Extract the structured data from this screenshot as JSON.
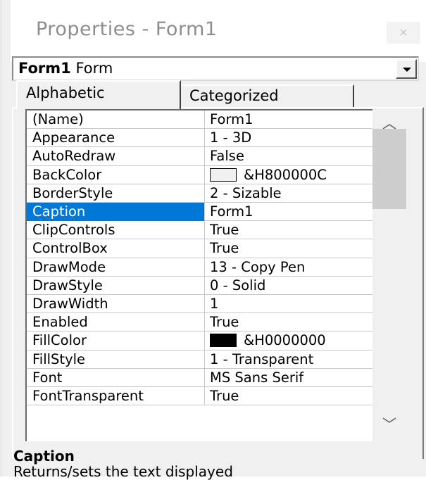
{
  "window": {
    "title": "Properties - Form1",
    "close_glyph": "×"
  },
  "object_selector": {
    "name": "Form1",
    "type": "Form"
  },
  "tabs": [
    {
      "label": "Alphabetic",
      "active": true
    },
    {
      "label": "Categorized",
      "active": false
    }
  ],
  "properties": [
    {
      "name": "(Name)",
      "value": "Form1"
    },
    {
      "name": "Appearance",
      "value": "1 - 3D"
    },
    {
      "name": "AutoRedraw",
      "value": "False"
    },
    {
      "name": "BackColor",
      "value": "&H800000C",
      "swatch": "#f0f0f0"
    },
    {
      "name": "BorderStyle",
      "value": "2 - Sizable"
    },
    {
      "name": "Caption",
      "value": "Form1",
      "selected": true
    },
    {
      "name": "ClipControls",
      "value": "True"
    },
    {
      "name": "ControlBox",
      "value": "True"
    },
    {
      "name": "DrawMode",
      "value": "13 - Copy Pen"
    },
    {
      "name": "DrawStyle",
      "value": "0 - Solid"
    },
    {
      "name": "DrawWidth",
      "value": "1"
    },
    {
      "name": "Enabled",
      "value": "True"
    },
    {
      "name": "FillColor",
      "value": "&H0000000",
      "swatch": "#000000"
    },
    {
      "name": "FillStyle",
      "value": "1 - Transparent"
    },
    {
      "name": "Font",
      "value": "MS Sans Serif"
    },
    {
      "name": "FontTransparent",
      "value": "True"
    }
  ],
  "description": {
    "title": "Caption",
    "text": "Returns/sets the text displayed"
  },
  "colors": {
    "selection": "#0078d7"
  }
}
